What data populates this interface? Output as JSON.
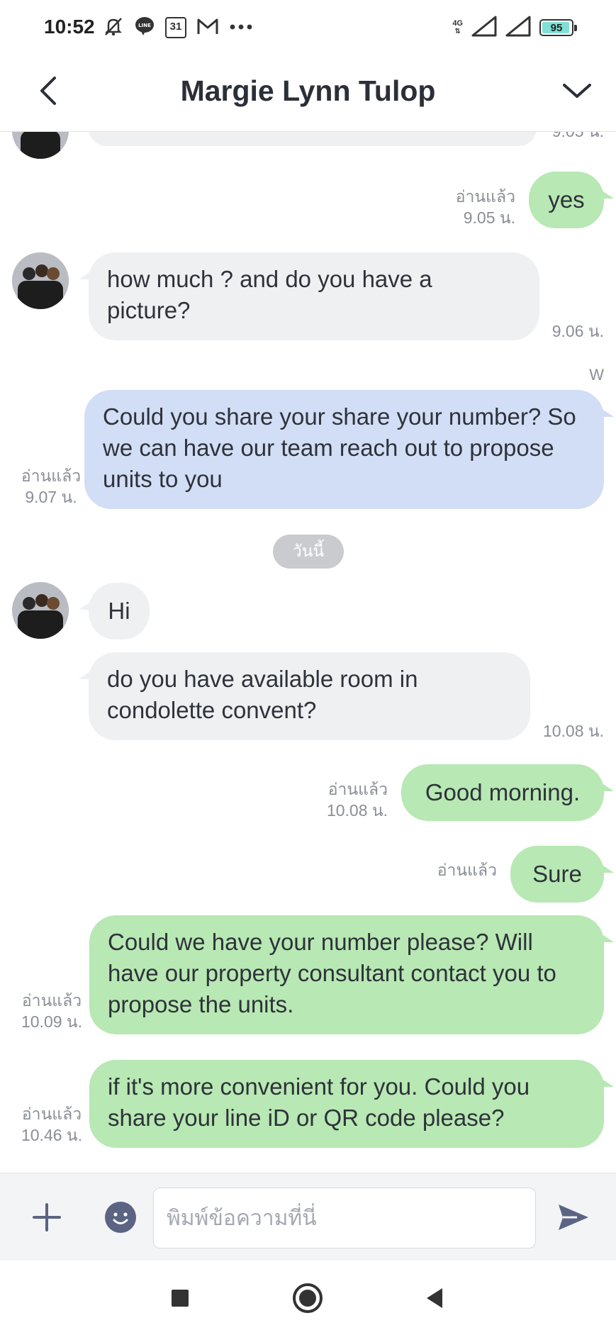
{
  "status_bar": {
    "time": "10:52",
    "icons": [
      "muted-bell-icon",
      "line-app-icon",
      "calendar-icon",
      "gmail-icon",
      "more-dots-icon"
    ],
    "calendar_day": "31",
    "network_label": "4G",
    "battery_percent": "95",
    "battery_level": 0.95
  },
  "header": {
    "title": "Margie Lynn Tulop"
  },
  "messages": {
    "partial_top": {
      "time": "9.05 น."
    },
    "m1": {
      "text": "yes",
      "read": "อ่านแล้ว",
      "time": "9.05 น."
    },
    "m2": {
      "text": "how much ? and do you have a picture?",
      "time": "9.06 น."
    },
    "m3": {
      "sender": "W",
      "text": "Could you share your share your number? So we can have our team reach out to propose units to you",
      "read": "อ่านแล้ว",
      "time": "9.07 น."
    },
    "date_divider": "วันนี้",
    "m4": {
      "text": "Hi"
    },
    "m5": {
      "text": "do you have available room in condolette convent?",
      "time": "10.08 น."
    },
    "m6": {
      "text": "Good morning.",
      "read": "อ่านแล้ว",
      "time": "10.08 น."
    },
    "m7": {
      "text": "Sure",
      "read": "อ่านแล้ว"
    },
    "m8": {
      "text": "Could we have your number please? Will have our property consultant contact you to propose the units.",
      "read": "อ่านแล้ว",
      "time": "10.09 น."
    },
    "m9": {
      "text": "if it's more convenient for you. Could you share your line iD or QR code please?",
      "read": "อ่านแล้ว",
      "time": "10.46 น."
    }
  },
  "composer": {
    "placeholder": "พิมพ์ข้อความที่นี่"
  },
  "colors": {
    "incoming_bubble": "#eff0f2",
    "outgoing_bubble": "#b8e8b3",
    "highlight_bubble": "#d2def6",
    "accent": "#5b6482"
  }
}
